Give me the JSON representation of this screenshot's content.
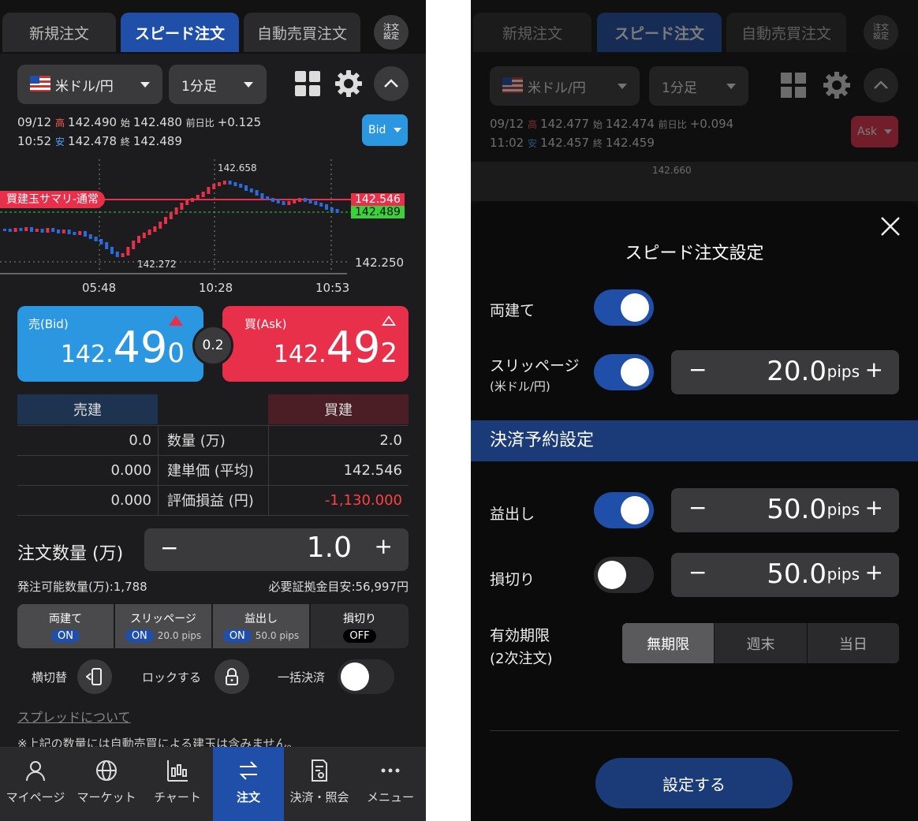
{
  "left": {
    "tabs": [
      "新規注文",
      "スピード注文",
      "自動売買注文"
    ],
    "settings_btn": "注文\n設定",
    "pair": "米ドル/円",
    "interval": "1分足",
    "side_select": "Bid",
    "info": {
      "date": "09/12",
      "time": "10:52",
      "high_label": "高",
      "high": "142.490",
      "open_label": "始",
      "open": "142.480",
      "prev_label": "前日比",
      "prev": "+0.125",
      "low_label": "安",
      "low": "142.478",
      "close_label": "終",
      "close": "142.489"
    },
    "chart": {
      "summary_label": "買建玉サマリ-通常",
      "price_top": "142.658",
      "price_low": "142.272",
      "tag_red": "142.546",
      "tag_green": "142.489",
      "axis_price": "142.250",
      "times": [
        "05:48",
        "10:28",
        "10:53"
      ]
    },
    "sell": {
      "label": "売(Bid)",
      "small": "142.",
      "big": "49",
      "last": "0"
    },
    "spread": "0.2",
    "buy": {
      "label": "買(Ask)",
      "small": "142.",
      "big": "49",
      "last": "2"
    },
    "table": {
      "h_sell": "売建",
      "h_buy": "買建",
      "rows": [
        {
          "s": "0.0",
          "k": "数量 (万)",
          "b": "2.0"
        },
        {
          "s": "0.000",
          "k": "建単価 (平均)",
          "b": "142.546"
        },
        {
          "s": "0.000",
          "k": "評価損益 (円)",
          "b": "-1,130.000"
        }
      ]
    },
    "qty_label": "注文数量 (万)",
    "qty": "1.0",
    "minus": "−",
    "plus": "+",
    "avail": "発注可能数量(万):1,788",
    "margin": "必要証拠金目安:56,997円",
    "segs": [
      {
        "t": "両建て",
        "v": "ON"
      },
      {
        "t": "スリッページ",
        "v": "ON",
        "x": "20.0 pips"
      },
      {
        "t": "益出し",
        "v": "ON",
        "x": "50.0 pips"
      },
      {
        "t": "損切り",
        "v": "OFF"
      }
    ],
    "row2": {
      "a": "横切替",
      "b": "ロックする",
      "c": "一括決済"
    },
    "link": "スプレッドについて",
    "note": "※上記の数量には自動売買による建玉は含みません。",
    "nav": [
      "マイページ",
      "マーケット",
      "チャート",
      "注文",
      "決済・照会",
      "メニュー"
    ],
    "colors": {
      "sell": "#2a97e0",
      "buy": "#e8304a",
      "accent": "#1f4fa8"
    }
  },
  "right": {
    "tabs": [
      "新規注文",
      "スピード注文",
      "自動売買注文"
    ],
    "settings_btn": "注文\n設定",
    "pair": "米ドル/円",
    "interval": "1分足",
    "side_select": "Ask",
    "info": {
      "date": "09/12",
      "time": "11:02",
      "high_label": "高",
      "high": "142.477",
      "open_label": "始",
      "open": "142.474",
      "prev_label": "前日比",
      "prev": "+0.094",
      "low_label": "安",
      "low": "142.457",
      "close_label": "終",
      "close": "142.459"
    },
    "chart_price": "142.660",
    "modal": {
      "title": "スピード注文設定",
      "hedge": "両建て",
      "slip": "スリッページ",
      "slip_sub": "(米ドル/円)",
      "slip_val": "20.0",
      "unit": "pips",
      "section": "決済予約設定",
      "tp": "益出し",
      "tp_val": "50.0",
      "sl": "損切り",
      "sl_val": "50.0",
      "expiry": "有効期限",
      "expiry_sub": "(2次注文)",
      "expiry_opts": [
        "無期限",
        "週末",
        "当日"
      ],
      "submit": "設定する",
      "minus": "−",
      "plus": "+"
    }
  }
}
